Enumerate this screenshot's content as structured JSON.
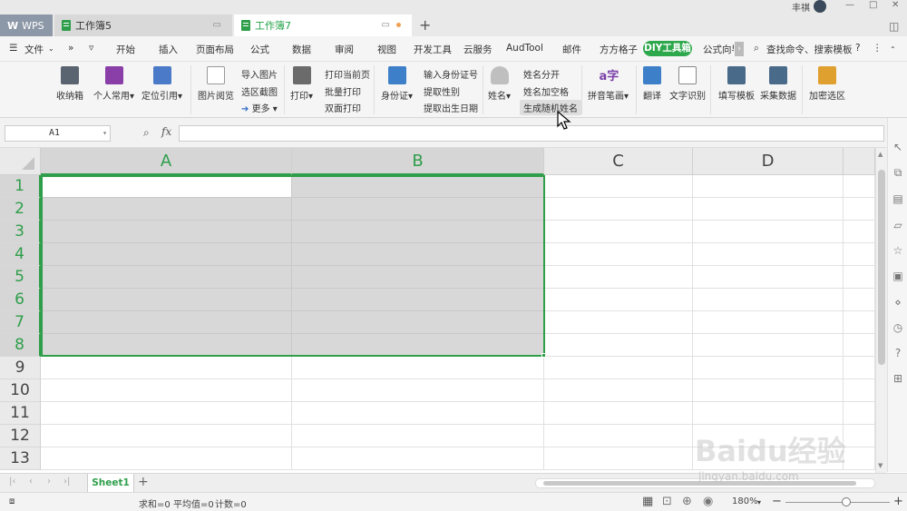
{
  "titlebar": {
    "tabs": [
      {
        "label": "WPS"
      },
      {
        "label": "工作簿5"
      },
      {
        "label": "工作簿7"
      }
    ],
    "new_tab": "+",
    "user_name": "丰祺"
  },
  "menubar": {
    "file_label": "文件",
    "items": [
      "开始",
      "插入",
      "页面布局",
      "公式",
      "数据",
      "审阅",
      "视图",
      "开发工具",
      "云服务",
      "AudTool",
      "邮件",
      "方方格子",
      "DIY工具箱",
      "公式向导"
    ],
    "search_label": "查找命令、搜索模板"
  },
  "ribbon": {
    "storage": "收纳箱",
    "personal": "个人常用",
    "locate_ref": "定位引用",
    "image_view": "图片阅览",
    "import_image": "导入图片",
    "region_screenshot": "选区截图",
    "more": "更多",
    "print": "打印",
    "print_current": "打印当前页",
    "batch_print": "批量打印",
    "duplex_print": "双面打印",
    "id_card": "身份证",
    "input_id": "输入身份证号",
    "extract_gender": "提取性别",
    "extract_birthday": "提取出生日期",
    "name": "姓名",
    "split_name": "姓名分开",
    "name_add_space": "姓名加空格",
    "random_name": "生成随机姓名",
    "pinyin": "拼音笔画",
    "translate": "翻译",
    "ocr": "文字识别",
    "fill_template": "填写模板",
    "collect_data": "采集数据",
    "encrypt_region": "加密选区"
  },
  "formula_bar": {
    "name_box": "A1",
    "fx_label": "fx",
    "value": ""
  },
  "grid": {
    "columns": [
      "A",
      "B",
      "C",
      "D"
    ],
    "rows": [
      "1",
      "2",
      "3",
      "4",
      "5",
      "6",
      "7",
      "8",
      "9",
      "10",
      "11",
      "12",
      "13"
    ],
    "selected_range": "A1:B8"
  },
  "sheets": {
    "tabs": [
      "Sheet1"
    ],
    "add": "+"
  },
  "status": {
    "sum": "求和=0",
    "average": "平均值=0",
    "count": "计数=0",
    "zoom": "180%"
  },
  "watermark": {
    "logo_text": "Baidu经验",
    "url": "jingyan.baidu.com"
  },
  "colors": {
    "accent": "#2e9e4a",
    "selection_fill": "#d8d8d8"
  }
}
